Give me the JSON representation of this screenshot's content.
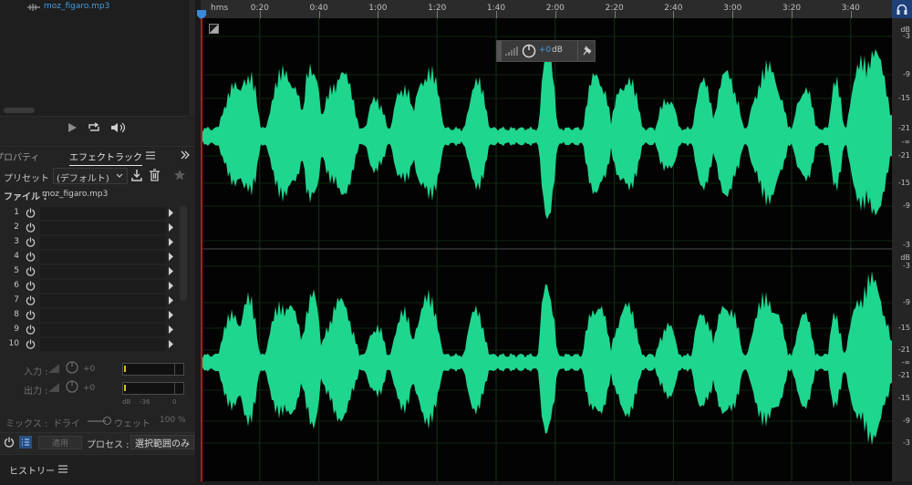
{
  "files_panel": {
    "file_name": "moz_figaro.mp3"
  },
  "panel_tabs": {
    "properties": "プロパティ",
    "effects_rack": "エフェクトラック"
  },
  "preset": {
    "label": "プリセット :",
    "value": "(デフォルト)"
  },
  "file_row": {
    "label": "ファイル :",
    "value": "moz_figaro.mp3"
  },
  "rack": {
    "slots": [
      "1",
      "2",
      "3",
      "4",
      "5",
      "6",
      "7",
      "8",
      "9",
      "10"
    ]
  },
  "levels": {
    "input_label": "入力 :",
    "input_value": "+0",
    "output_label": "出力 :",
    "output_value": "+0",
    "meter_labels": {
      "unit": "dB",
      "mid": "-36",
      "zero": "0"
    }
  },
  "mix": {
    "label": "ミックス :",
    "dry": "ドライ",
    "wet": "ウェット",
    "value": "100 %"
  },
  "actions": {
    "apply": "適用",
    "process_label": "プロセス :",
    "process_value": "選択範囲のみ"
  },
  "history": {
    "title": "ヒストリー"
  },
  "ruler": {
    "unit": "hms",
    "ticks": [
      "0:20",
      "0:40",
      "1:00",
      "1:20",
      "1:40",
      "2:00",
      "2:20",
      "2:40",
      "3:00",
      "3:20",
      "3:40"
    ]
  },
  "hud": {
    "value": "+0",
    "unit": "dB"
  },
  "db_scale": {
    "unit": "dB",
    "upper": [
      "-3",
      "-9",
      "-15",
      "-21",
      "-∞",
      "-21",
      "-15",
      "-9",
      "-3"
    ],
    "lower": [
      "-3",
      "-9",
      "-15",
      "-21",
      "-∞",
      "-21",
      "-15",
      "-9",
      "-3"
    ]
  },
  "colors": {
    "waveform": "#1fd68f",
    "playhead": "#3d87d8",
    "background": "#030303",
    "accent": "#3d9ee8"
  }
}
